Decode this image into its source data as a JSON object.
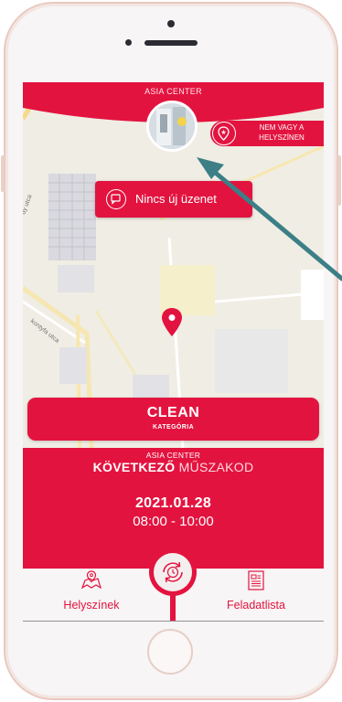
{
  "header": {
    "location_title": "ASIA CENTER",
    "status_badge": "NEM VAGY A HELYSZÍNEN"
  },
  "messages": {
    "label": "Nincs új üzenet"
  },
  "map": {
    "streets": [
      "kontyfa utca",
      "dy utca"
    ]
  },
  "category": {
    "name": "CLEAN",
    "label": "KATEGÓRIA"
  },
  "next_shift": {
    "location": "ASIA CENTER",
    "next_word": "KÖVETKEZŐ",
    "shift_word": "MŰSZAKOD",
    "date": "2021.01.28",
    "time": "08:00 - 10:00"
  },
  "nav": {
    "left_label": "Helyszínek",
    "right_label": "Feladatlista"
  },
  "colors": {
    "primary": "#e3133f",
    "arrow": "#3c7f86",
    "map_bg": "#f0ede4"
  }
}
